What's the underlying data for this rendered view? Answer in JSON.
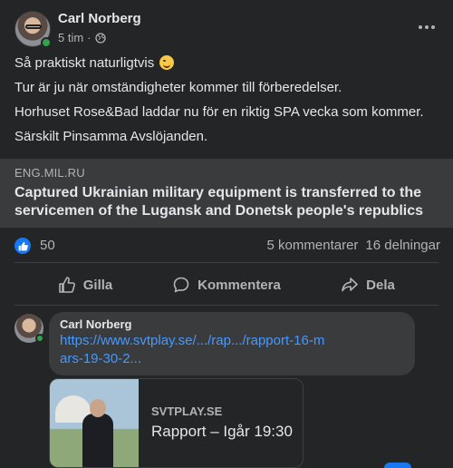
{
  "post": {
    "author": "Carl Norberg",
    "time": "5 tim",
    "separator": "·",
    "privacy_icon": "globe-icon",
    "menu_icon": "more-options-icon",
    "lines": [
      "Så praktiskt naturligtvis",
      "Tur är ju när omständigheter kommer till förberedelser.",
      "Horhuset Rose&Bad laddar nu för en riktig SPA vecka som kommer.",
      "Särskilt Pinsamma Avslöjanden."
    ],
    "emoji": "winking-face-emoji"
  },
  "link_card": {
    "domain": "ENG.MIL.RU",
    "title": "Captured Ukrainian military equipment is transferred to the servicemen of the Lugansk and Donetsk people's republics"
  },
  "stats": {
    "likes": "50",
    "comments": "5 kommentarer",
    "shares": "16 delningar"
  },
  "actions": {
    "like": "Gilla",
    "comment": "Kommentera",
    "share": "Dela"
  },
  "comment": {
    "author": "Carl Norberg",
    "link_text": "https://www.svtplay.se/.../rap.../rapport-16-mars-19-30-2...",
    "preview": {
      "domain": "SVTPLAY.SE",
      "title": "Rapport – Igår 19:30"
    }
  },
  "colors": {
    "background": "#242526",
    "card": "#3a3b3c",
    "accent": "#1877f2",
    "link": "#4599ff",
    "online": "#31a24c"
  }
}
